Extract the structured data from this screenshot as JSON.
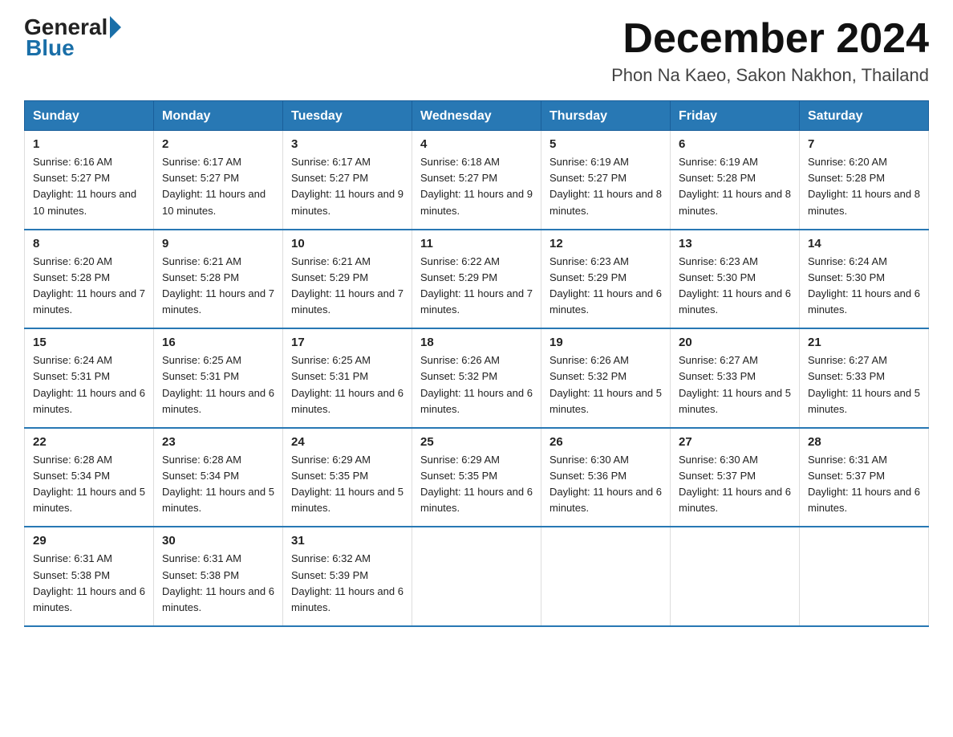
{
  "logo": {
    "general": "General",
    "blue": "Blue"
  },
  "header": {
    "title": "December 2024",
    "subtitle": "Phon Na Kaeo, Sakon Nakhon, Thailand"
  },
  "days_of_week": [
    "Sunday",
    "Monday",
    "Tuesday",
    "Wednesday",
    "Thursday",
    "Friday",
    "Saturday"
  ],
  "weeks": [
    [
      {
        "day": "1",
        "sunrise": "6:16 AM",
        "sunset": "5:27 PM",
        "daylight": "11 hours and 10 minutes."
      },
      {
        "day": "2",
        "sunrise": "6:17 AM",
        "sunset": "5:27 PM",
        "daylight": "11 hours and 10 minutes."
      },
      {
        "day": "3",
        "sunrise": "6:17 AM",
        "sunset": "5:27 PM",
        "daylight": "11 hours and 9 minutes."
      },
      {
        "day": "4",
        "sunrise": "6:18 AM",
        "sunset": "5:27 PM",
        "daylight": "11 hours and 9 minutes."
      },
      {
        "day": "5",
        "sunrise": "6:19 AM",
        "sunset": "5:27 PM",
        "daylight": "11 hours and 8 minutes."
      },
      {
        "day": "6",
        "sunrise": "6:19 AM",
        "sunset": "5:28 PM",
        "daylight": "11 hours and 8 minutes."
      },
      {
        "day": "7",
        "sunrise": "6:20 AM",
        "sunset": "5:28 PM",
        "daylight": "11 hours and 8 minutes."
      }
    ],
    [
      {
        "day": "8",
        "sunrise": "6:20 AM",
        "sunset": "5:28 PM",
        "daylight": "11 hours and 7 minutes."
      },
      {
        "day": "9",
        "sunrise": "6:21 AM",
        "sunset": "5:28 PM",
        "daylight": "11 hours and 7 minutes."
      },
      {
        "day": "10",
        "sunrise": "6:21 AM",
        "sunset": "5:29 PM",
        "daylight": "11 hours and 7 minutes."
      },
      {
        "day": "11",
        "sunrise": "6:22 AM",
        "sunset": "5:29 PM",
        "daylight": "11 hours and 7 minutes."
      },
      {
        "day": "12",
        "sunrise": "6:23 AM",
        "sunset": "5:29 PM",
        "daylight": "11 hours and 6 minutes."
      },
      {
        "day": "13",
        "sunrise": "6:23 AM",
        "sunset": "5:30 PM",
        "daylight": "11 hours and 6 minutes."
      },
      {
        "day": "14",
        "sunrise": "6:24 AM",
        "sunset": "5:30 PM",
        "daylight": "11 hours and 6 minutes."
      }
    ],
    [
      {
        "day": "15",
        "sunrise": "6:24 AM",
        "sunset": "5:31 PM",
        "daylight": "11 hours and 6 minutes."
      },
      {
        "day": "16",
        "sunrise": "6:25 AM",
        "sunset": "5:31 PM",
        "daylight": "11 hours and 6 minutes."
      },
      {
        "day": "17",
        "sunrise": "6:25 AM",
        "sunset": "5:31 PM",
        "daylight": "11 hours and 6 minutes."
      },
      {
        "day": "18",
        "sunrise": "6:26 AM",
        "sunset": "5:32 PM",
        "daylight": "11 hours and 6 minutes."
      },
      {
        "day": "19",
        "sunrise": "6:26 AM",
        "sunset": "5:32 PM",
        "daylight": "11 hours and 5 minutes."
      },
      {
        "day": "20",
        "sunrise": "6:27 AM",
        "sunset": "5:33 PM",
        "daylight": "11 hours and 5 minutes."
      },
      {
        "day": "21",
        "sunrise": "6:27 AM",
        "sunset": "5:33 PM",
        "daylight": "11 hours and 5 minutes."
      }
    ],
    [
      {
        "day": "22",
        "sunrise": "6:28 AM",
        "sunset": "5:34 PM",
        "daylight": "11 hours and 5 minutes."
      },
      {
        "day": "23",
        "sunrise": "6:28 AM",
        "sunset": "5:34 PM",
        "daylight": "11 hours and 5 minutes."
      },
      {
        "day": "24",
        "sunrise": "6:29 AM",
        "sunset": "5:35 PM",
        "daylight": "11 hours and 5 minutes."
      },
      {
        "day": "25",
        "sunrise": "6:29 AM",
        "sunset": "5:35 PM",
        "daylight": "11 hours and 6 minutes."
      },
      {
        "day": "26",
        "sunrise": "6:30 AM",
        "sunset": "5:36 PM",
        "daylight": "11 hours and 6 minutes."
      },
      {
        "day": "27",
        "sunrise": "6:30 AM",
        "sunset": "5:37 PM",
        "daylight": "11 hours and 6 minutes."
      },
      {
        "day": "28",
        "sunrise": "6:31 AM",
        "sunset": "5:37 PM",
        "daylight": "11 hours and 6 minutes."
      }
    ],
    [
      {
        "day": "29",
        "sunrise": "6:31 AM",
        "sunset": "5:38 PM",
        "daylight": "11 hours and 6 minutes."
      },
      {
        "day": "30",
        "sunrise": "6:31 AM",
        "sunset": "5:38 PM",
        "daylight": "11 hours and 6 minutes."
      },
      {
        "day": "31",
        "sunrise": "6:32 AM",
        "sunset": "5:39 PM",
        "daylight": "11 hours and 6 minutes."
      },
      null,
      null,
      null,
      null
    ]
  ]
}
